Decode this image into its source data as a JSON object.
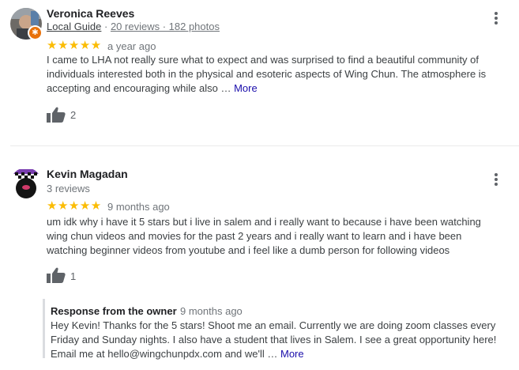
{
  "reviews": [
    {
      "name": "Veronica Reeves",
      "guide_label": "Local Guide",
      "separator": " · ",
      "counts": "20 reviews · 182 photos",
      "stars": "★★★★★",
      "date": "a year ago",
      "text": "I came to LHA not really sure what to expect and was surprised to find a beautiful community of individuals interested both in the physical and esoteric aspects of  Wing Chun. The atmosphere is accepting and encouraging while also",
      "ellipsis": " … ",
      "more": "More",
      "likes": "2"
    },
    {
      "name": "Kevin Magadan",
      "counts": "3 reviews",
      "stars": "★★★★★",
      "date": "9 months ago",
      "text": "um  idk why i have it 5 stars but i live in salem and i really want to  because i have been watching wing chun videos and movies for the past 2 years and i really want to learn and i have been watching beginner videos from youtube and i feel like a dumb person for following videos",
      "likes": "1",
      "response": {
        "title": "Response from the owner",
        "date": "9 months ago",
        "text": "Hey Kevin! Thanks for the 5 stars! Shoot me an email. Currently we are doing zoom classes every Friday and Sunday nights. I also have a student that lives in Salem. I see a great opportunity here! Email me at hello@wingchunpdx.com and we'll",
        "ellipsis": " … ",
        "more": "More"
      }
    }
  ],
  "colors": {
    "star": "#fbbc04",
    "link": "#1a0dab",
    "badge": "#e8710a"
  },
  "icons": {
    "menu": "more-vert-icon",
    "like": "thumbs-up-icon",
    "guide_badge": "local-guide-badge-icon"
  }
}
